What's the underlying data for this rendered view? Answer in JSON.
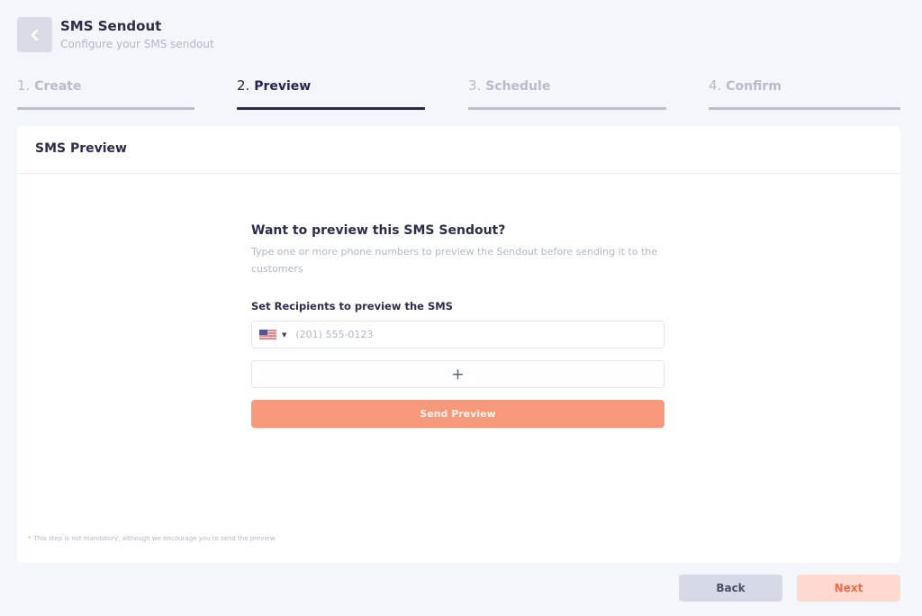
{
  "header": {
    "title": "SMS Sendout",
    "subtitle": "Configure your SMS sendout"
  },
  "steps": [
    {
      "num": "1.",
      "label": "Create",
      "active": false
    },
    {
      "num": "2.",
      "label": "Preview",
      "active": true
    },
    {
      "num": "3.",
      "label": "Schedule",
      "active": false
    },
    {
      "num": "4.",
      "label": "Confirm",
      "active": false
    }
  ],
  "card": {
    "title": "SMS Preview",
    "form": {
      "title": "Want to preview this SMS Sendout?",
      "description": "Type one or more phone numbers to preview the Sendout before sending it to the customers",
      "recipients_label": "Set Recipients to preview the SMS",
      "phone_placeholder": "(201) 555-0123",
      "phone_value": "",
      "country": "US",
      "add_label": "+",
      "send_label": "Send Preview"
    },
    "note": "This step is not mandatory, although we encourage you to send the preview.",
    "note_marker": "*"
  },
  "footer": {
    "back_label": "Back",
    "next_label": "Next"
  },
  "colors": {
    "accent": "#f6997b",
    "active_step": "#262556",
    "next_text": "#f26a45"
  }
}
